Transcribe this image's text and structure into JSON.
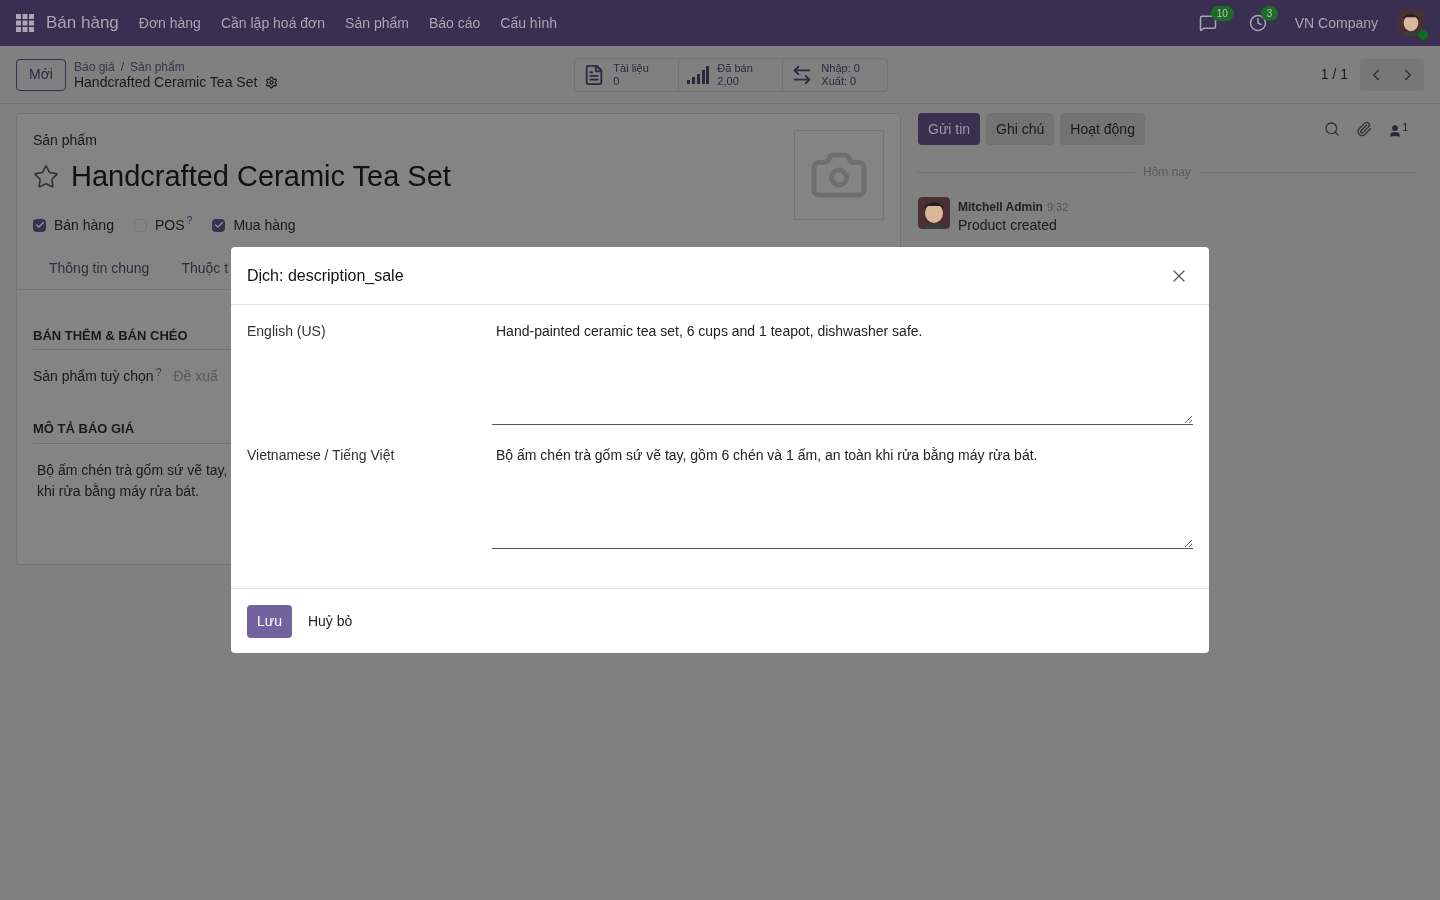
{
  "navbar": {
    "app": "Bán hàng",
    "menu": [
      "Đơn hàng",
      "Cần lập hoá đơn",
      "Sản phẩm",
      "Báo cáo",
      "Cấu hình"
    ],
    "messages_badge": "10",
    "activities_badge": "3",
    "company": "VN Company"
  },
  "control_panel": {
    "new_button": "Mới",
    "breadcrumb": [
      "Báo giá",
      "Sản phẩm"
    ],
    "breadcrumb_separator": "/",
    "record_title": "Handcrafted Ceramic Tea Set",
    "smart_buttons": [
      {
        "kind": "document",
        "lines": [
          "Tài liệu",
          "0"
        ]
      },
      {
        "kind": "chart",
        "lines": [
          "Đã bán",
          "2,00"
        ]
      },
      {
        "kind": "transfer",
        "lines": [
          "Nhập: 0",
          "Xuất: 0"
        ]
      }
    ],
    "pager": "1 / 1"
  },
  "form": {
    "label": "Sản phẩm",
    "name": "Handcrafted Ceramic Tea Set",
    "favorite": false,
    "options": [
      {
        "label": "Bán hàng",
        "checked": true
      },
      {
        "label": "POS",
        "checked": false,
        "help": "?"
      },
      {
        "label": "Mua hàng",
        "checked": true
      }
    ],
    "tabs": [
      {
        "label": "Thông tin chung",
        "selected": false
      },
      {
        "label": "Thuộc t",
        "selected": false
      }
    ],
    "sections": [
      {
        "kind": "fields",
        "title": "BÁN THÊM & BÁN CHÉO",
        "field": {
          "label": "Sản phẩm tuỳ chọn",
          "help": "?",
          "placeholder": "Đề xuấ"
        }
      },
      {
        "kind": "text",
        "title": "MÔ TẢ BÁO GIÁ",
        "lines": [
          "Bộ ấm chén trà gốm sứ vẽ tay,",
          "khi rửa bằng máy rửa bát."
        ]
      }
    ]
  },
  "chatter": {
    "buttons": [
      {
        "label": "Gửi tin",
        "selected": true
      },
      {
        "label": "Ghi chú",
        "selected": false
      },
      {
        "label": "Hoạt động",
        "selected": false
      }
    ],
    "followers": "1",
    "date": "Hôm nay",
    "messages": [
      {
        "author": "Mitchell Admin",
        "time": "9:32",
        "body": "Product created"
      }
    ]
  },
  "dialog": {
    "title": "Dịch: description_sale",
    "rows": [
      {
        "language": "English (US)",
        "value": "Hand-painted ceramic tea set, 6 cups and 1 teapot, dishwasher safe."
      },
      {
        "language": "Vietnamese / Tiếng Việt",
        "value": "Bộ ấm chén trà gốm sứ vẽ tay, gồm 6 chén và 1 ấm, an toàn khi rửa bằng máy rửa bát."
      }
    ],
    "save": "Lưu",
    "cancel": "Huỷ bỏ"
  }
}
